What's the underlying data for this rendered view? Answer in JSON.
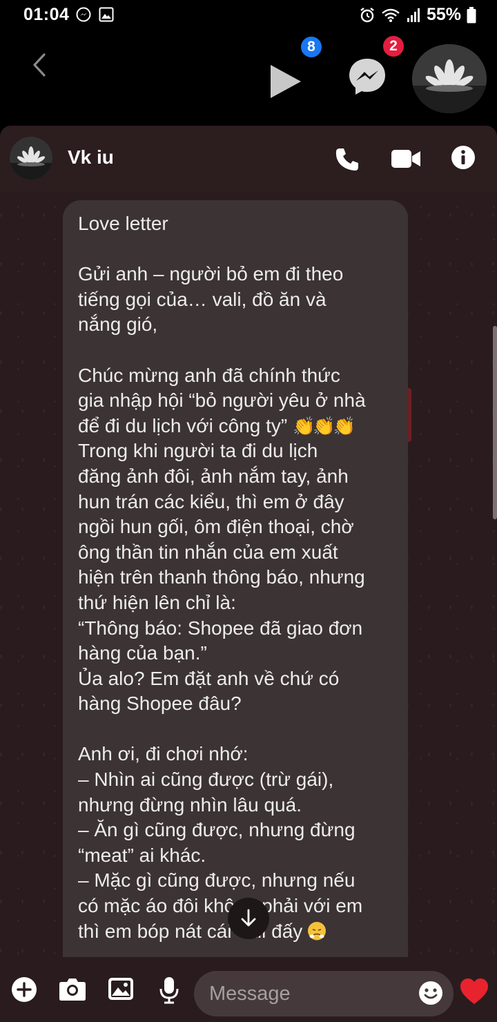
{
  "status_bar": {
    "time": "01:04",
    "battery": "55%"
  },
  "bubbles": {
    "play_badge": "8",
    "messenger_badge": "2"
  },
  "chat": {
    "contact_name": "Vk iu",
    "message": {
      "title": "Love letter",
      "para1": "Gửi anh – người bỏ em đi theo\ntiếng gọi của… vali, đồ ăn và\nnắng gió,",
      "para2_line1": "Chúc mừng anh đã chính thức",
      "para2_line2": "gia nhập hội “bỏ người yêu ở nhà",
      "para2_line3": "để đi du lịch với công ty”",
      "para2_rest": "Trong khi người ta đi du lịch\nđăng ảnh đôi, ảnh nắm tay, ảnh\nhun trán các kiểu, thì em ở đây\nngồi hun gối, ôm điện thoại, chờ\nông thần tin nhắn của em xuất\nhiện trên thanh thông báo, nhưng\nthứ hiện lên chỉ là:\n“Thông báo: Shopee đã giao đơn\nhàng của bạn.”\nỦa alo? Em đặt anh về chứ có\nhàng Shopee đâu?",
      "para3": "Anh ơi, đi chơi nhớ:\n– Nhìn ai cũng được (trừ gái),\nnhưng đừng nhìn lâu quá.\n– Ăn gì cũng được, nhưng đừng\n“meat” ai khác.\n– Mặc gì cũng được, nhưng nếu\ncó mặc áo đôi không phải với em",
      "last_line": "thì em bóp nát cái vali đấy",
      "clap_emoji": "👏👏👏"
    }
  },
  "composer": {
    "placeholder": "Message"
  },
  "icons": {
    "alarm": "alarm-icon",
    "wifi": "wifi-icon",
    "signal": "signal-icon",
    "battery": "battery-icon",
    "back": "chevron-left-icon",
    "play": "play-icon",
    "messenger": "messenger-icon",
    "phone": "phone-icon",
    "video": "video-icon",
    "info": "info-icon",
    "add": "plus-icon",
    "camera": "camera-icon",
    "gallery": "image-icon",
    "mic": "mic-icon",
    "emoji": "smiley-icon",
    "heart": "heart-icon",
    "scroll_down": "arrow-down-icon"
  },
  "colors": {
    "panel_bg": "#2a1c1e",
    "bubble_bg": "#3c3334",
    "badge_blue": "#1877f2",
    "badge_red": "#e41e3f",
    "heart_red": "#e8232e"
  }
}
